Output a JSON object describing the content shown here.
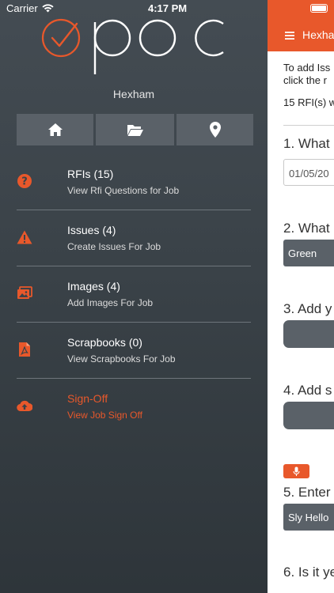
{
  "status_bar": {
    "carrier": "Carrier",
    "time": "4:17 PM"
  },
  "job_name": "Hexham",
  "quick_actions": [
    {
      "icon": "home-icon"
    },
    {
      "icon": "folder-open-icon"
    },
    {
      "icon": "map-pin-icon"
    }
  ],
  "menu": [
    {
      "icon": "question-circle-icon",
      "title": "RFIs (15)",
      "subtitle": "View Rfi Questions for Job",
      "accent": false
    },
    {
      "icon": "warning-triangle-icon",
      "title": "Issues (4)",
      "subtitle": "Create Issues For Job",
      "accent": false
    },
    {
      "icon": "images-icon",
      "title": "Images (4)",
      "subtitle": "Add Images For Job",
      "accent": false
    },
    {
      "icon": "pdf-file-icon",
      "title": "Scrapbooks (0)",
      "subtitle": "View Scrapbooks For Job",
      "accent": false
    },
    {
      "icon": "cloud-upload-icon",
      "title": "Sign-Off",
      "subtitle": "View Job Sign Off",
      "accent": true
    }
  ],
  "content": {
    "header_title": "Hexha",
    "intro_line1": "To add Iss",
    "intro_line2": "click the r",
    "rfi_count_text": "15 RFI(s) w",
    "q1": "1. What",
    "q1_value": "01/05/20",
    "q2": "2. What",
    "q2_value": "Green",
    "q3": "3. Add y",
    "q4": "4. Add s",
    "q5": "5. Enter",
    "q5_value": "Sly Hello",
    "q6": "6. Is it ye"
  },
  "colors": {
    "accent": "#e8582b",
    "panel": "#3a4248",
    "tile": "#5a6168"
  }
}
